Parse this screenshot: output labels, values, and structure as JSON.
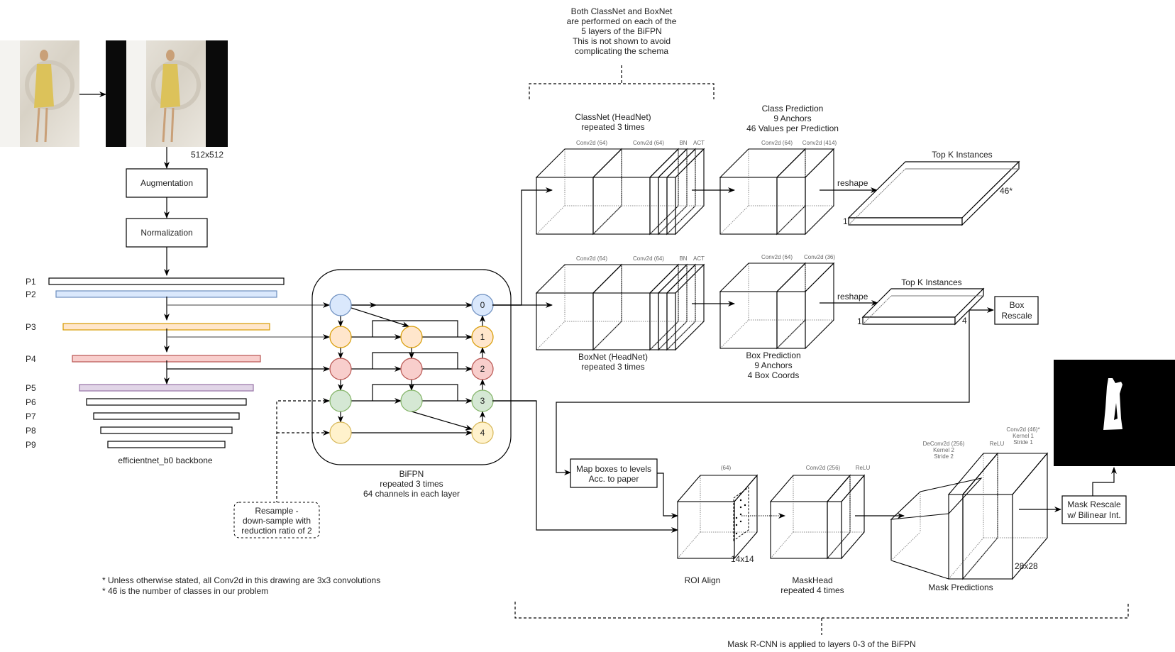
{
  "input": {
    "size_label": "512x512",
    "augmentation_label": "Augmentation",
    "normalization_label": "Normalization"
  },
  "backbone": {
    "title": "efficientnet_b0 backbone",
    "levels": [
      {
        "label": "P1",
        "color": "#ffffff",
        "stroke": "#000000"
      },
      {
        "label": "P2",
        "color": "#dae8fc",
        "stroke": "#6c8ebf"
      },
      {
        "label": "P3",
        "color": "#ffe6cc",
        "stroke": "#d79b00"
      },
      {
        "label": "P4",
        "color": "#f8cecc",
        "stroke": "#b85450"
      },
      {
        "label": "P5",
        "color": "#e1d5e7",
        "stroke": "#9673a6"
      },
      {
        "label": "P6",
        "color": "#ffffff",
        "stroke": "#000000"
      },
      {
        "label": "P7",
        "color": "#ffffff",
        "stroke": "#000000"
      },
      {
        "label": "P8",
        "color": "#ffffff",
        "stroke": "#000000"
      },
      {
        "label": "P9",
        "color": "#ffffff",
        "stroke": "#000000"
      }
    ]
  },
  "resample_note": {
    "line1": "Resample -",
    "line2": "down-sample with",
    "line3": "reduction ratio of 2"
  },
  "bifpn": {
    "title": "BiFPN",
    "line2": "repeated 3 times",
    "line3": "64 channels in each layer",
    "node_colors": [
      {
        "fill": "#dae8fc",
        "stroke": "#6c8ebf"
      },
      {
        "fill": "#ffe6cc",
        "stroke": "#d79b00"
      },
      {
        "fill": "#f8cecc",
        "stroke": "#b85450"
      },
      {
        "fill": "#d5e8d4",
        "stroke": "#82b366"
      },
      {
        "fill": "#fff2cc",
        "stroke": "#d6b656"
      }
    ],
    "output_labels": [
      "0",
      "1",
      "2",
      "3",
      "4"
    ]
  },
  "top_note": {
    "line1": "Both ClassNet and BoxNet",
    "line2": "are performed on each of the",
    "line3": "5 layers of the BiFPN",
    "line4": "This is not shown to avoid",
    "line5": "complicating the schema"
  },
  "classnet": {
    "title": "ClassNet (HeadNet)",
    "subtitle": "repeated 3 times",
    "layers": [
      "Conv2d (64)",
      "Conv2d (64)",
      "BN",
      "ACT"
    ]
  },
  "class_prediction": {
    "title": "Class Prediction",
    "line2": "9 Anchors",
    "line3": "46 Values per Prediction",
    "layers": [
      "Conv2d (64)",
      "Conv2d (414)"
    ],
    "reshape_label": "reshape",
    "topk_label": "Top K Instances",
    "dim_left": "1",
    "dim_right": "46*"
  },
  "boxnet": {
    "title": "BoxNet (HeadNet)",
    "subtitle": "repeated 3 times",
    "layers": [
      "Conv2d (64)",
      "Conv2d (64)",
      "BN",
      "ACT"
    ]
  },
  "box_prediction": {
    "title": "Box Prediction",
    "line2": "9 Anchors",
    "line3": "4 Box Coords",
    "layers": [
      "Conv2d (64)",
      "Conv2d (36)"
    ],
    "reshape_label": "reshape",
    "topk_label": "Top K Instances",
    "dim_left": "1",
    "dim_right": "4",
    "rescale_line1": "Box",
    "rescale_line2": "Rescale"
  },
  "mask_rcnn": {
    "map_line1": "Map boxes to levels",
    "map_line2": "Acc. to paper",
    "roi_channels": "(64)",
    "roi_size": "14x14",
    "roi_title": "ROI Align",
    "maskhead_layers": [
      "Conv2d (256)",
      "ReLU"
    ],
    "maskhead_title": "MaskHead",
    "maskhead_subtitle": "repeated 4 times",
    "deconv_line1": "DeConv2d (256)",
    "deconv_line2": "Kernel 2",
    "deconv_line3": "Stride 2",
    "relu_label": "ReLU",
    "final_conv_line1": "Conv2d (46)*",
    "final_conv_line2": "Kernel 1",
    "final_conv_line3": "Stride 1",
    "pred_size": "28x28",
    "pred_title": "Mask Predictions",
    "rescale_line1": "Mask Rescale",
    "rescale_line2": "w/ Bilinear Int.",
    "bottom_note": "Mask R-CNN is applied to layers 0-3 of the BiFPN"
  },
  "footnotes": {
    "line1": "* Unless otherwise stated, all Conv2d in this drawing are 3x3 convolutions",
    "line2": "* 46 is the number of classes in our problem"
  }
}
